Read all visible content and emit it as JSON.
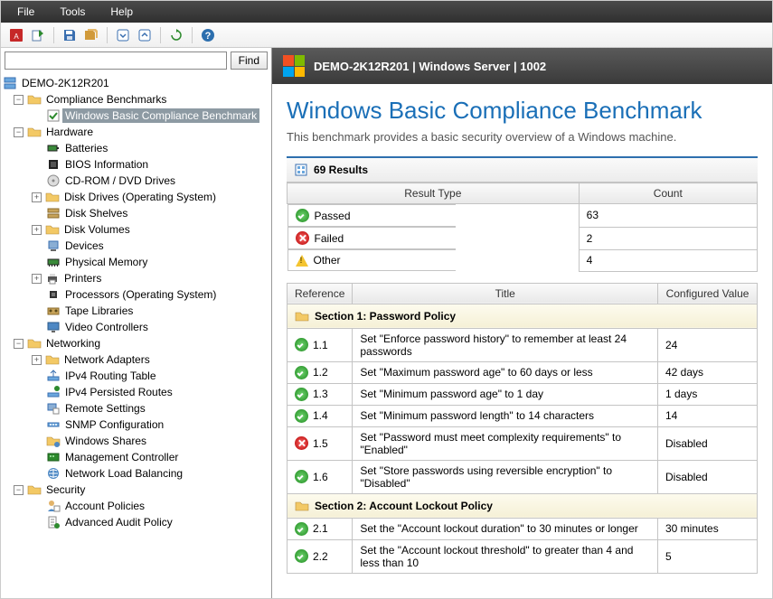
{
  "menu": {
    "file": "File",
    "tools": "Tools",
    "help": "Help"
  },
  "search": {
    "find": "Find",
    "value": ""
  },
  "tree": {
    "root": "DEMO-2K12R201",
    "compliance": "Compliance Benchmarks",
    "compliance_item": "Windows Basic Compliance Benchmark",
    "hardware": "Hardware",
    "hw": {
      "batteries": "Batteries",
      "bios": "BIOS Information",
      "cdrom": "CD-ROM / DVD Drives",
      "diskdrives": "Disk Drives (Operating System)",
      "diskshelves": "Disk Shelves",
      "diskvolumes": "Disk Volumes",
      "devices": "Devices",
      "physmem": "Physical Memory",
      "printers": "Printers",
      "processors": "Processors (Operating System)",
      "tape": "Tape Libraries",
      "video": "Video Controllers"
    },
    "networking": "Networking",
    "net": {
      "adapters": "Network Adapters",
      "ipv4rt": "IPv4 Routing Table",
      "ipv4pr": "IPv4 Persisted Routes",
      "remote": "Remote Settings",
      "snmp": "SNMP Configuration",
      "shares": "Windows Shares",
      "mgmt": "Management Controller",
      "nlb": "Network Load Balancing"
    },
    "security": "Security",
    "sec": {
      "accpol": "Account Policies",
      "advaudit": "Advanced Audit Policy"
    }
  },
  "header": {
    "title": "DEMO-2K12R201 | Windows Server | 1002"
  },
  "page": {
    "title": "Windows Basic Compliance Benchmark",
    "desc": "This benchmark provides a basic security overview of a Windows machine.",
    "results_label": "69 Results"
  },
  "summary": {
    "col_type": "Result Type",
    "col_count": "Count",
    "rows": [
      {
        "label": "Passed",
        "count": "63",
        "status": "pass"
      },
      {
        "label": "Failed",
        "count": "2",
        "status": "fail"
      },
      {
        "label": "Other",
        "count": "4",
        "status": "warn"
      }
    ]
  },
  "detail": {
    "col_ref": "Reference",
    "col_title": "Title",
    "col_val": "Configured Value",
    "sections": [
      {
        "name": "Section 1: Password Policy",
        "rows": [
          {
            "ref": "1.1",
            "title": "Set \"Enforce password history\" to remember at least 24 passwords",
            "val": "24",
            "status": "pass"
          },
          {
            "ref": "1.2",
            "title": "Set \"Maximum password age\" to 60 days or less",
            "val": "42 days",
            "status": "pass"
          },
          {
            "ref": "1.3",
            "title": "Set \"Minimum password age\" to 1 day",
            "val": "1 days",
            "status": "pass"
          },
          {
            "ref": "1.4",
            "title": "Set \"Minimum password length\" to 14 characters",
            "val": "14",
            "status": "pass"
          },
          {
            "ref": "1.5",
            "title": "Set \"Password must meet complexity requirements\" to \"Enabled\"",
            "val": "Disabled",
            "status": "fail"
          },
          {
            "ref": "1.6",
            "title": "Set \"Store passwords using reversible encryption\" to \"Disabled\"",
            "val": "Disabled",
            "status": "pass"
          }
        ]
      },
      {
        "name": "Section 2: Account Lockout Policy",
        "rows": [
          {
            "ref": "2.1",
            "title": "Set the \"Account lockout duration\" to 30 minutes or longer",
            "val": "30 minutes",
            "status": "pass"
          },
          {
            "ref": "2.2",
            "title": "Set the \"Account lockout threshold\" to greater than 4 and less than 10",
            "val": "5",
            "status": "pass"
          }
        ]
      }
    ]
  }
}
